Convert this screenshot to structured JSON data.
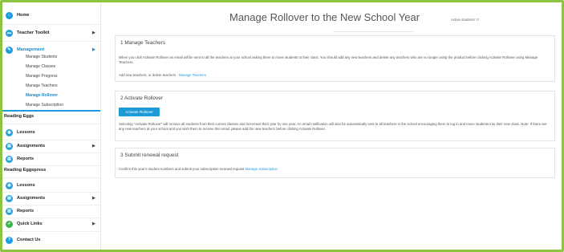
{
  "sidebar": {
    "home": "Home",
    "teacher_toolkit": "Teacher Toolkit",
    "management": "Management",
    "management_items": [
      "Manage Students",
      "Manage Classes",
      "Manage Progress",
      "Manage Teachers",
      "Manage Rollover",
      "Manage Subscription"
    ],
    "reading_eggs": "Reading Eggs",
    "re_lessons": "Lessons",
    "re_assignments": "Assignments",
    "re_reports": "Reports",
    "reading_eggspress": "Reading Eggspress",
    "rx_lessons": "Lessons",
    "rx_assignments": "Assignments",
    "rx_reports": "Reports",
    "quick_links": "Quick Links",
    "contact_us": "Contact Us"
  },
  "header": {
    "title": "Manage Rollover to the New School Year",
    "active_students": "Active students: 0"
  },
  "panels": {
    "p1": {
      "heading": "1  Manage Teachers",
      "text": "When you click Activate Rollover an email will be sent to all the teachers at your school asking them to move students to their class. You should add any new teachers and delete any teachers who are no longer using the product before clicking Activate Rollover using Manage Teachers.",
      "add_text": "Add new teachers, or delete teachers - ",
      "add_link": "Manage Teachers"
    },
    "p2": {
      "heading": "2  Activate Rollover",
      "button": "Activate Rollover",
      "text": "Selecting \"Activate Rollover\" will remove all students from their current classes and increment their year by one year. An email notification will also be automatically sent to all teachers in the school encouraging them to log in and move students into their new class. Note: If there are any new teachers at your school and you wish them to receive this email, please add the new teachers before clicking Activate Rollover."
    },
    "p3": {
      "heading": "3  Submit renewal request",
      "text": "Confirm this year's student numbers and submit your subscription renewal request ",
      "link": "Manage Subscription"
    }
  },
  "icons": {
    "home": "home-icon",
    "toolkit": "toolkit-icon",
    "management": "management-icon",
    "lessons": "lessons-icon",
    "assignments": "assignments-icon",
    "reports": "reports-icon",
    "quick_links": "quick-links-icon",
    "contact": "contact-icon"
  },
  "colors": {
    "frame": "#8cc63f",
    "accent": "#1e9ad6",
    "green_icon": "#3cb44b"
  }
}
